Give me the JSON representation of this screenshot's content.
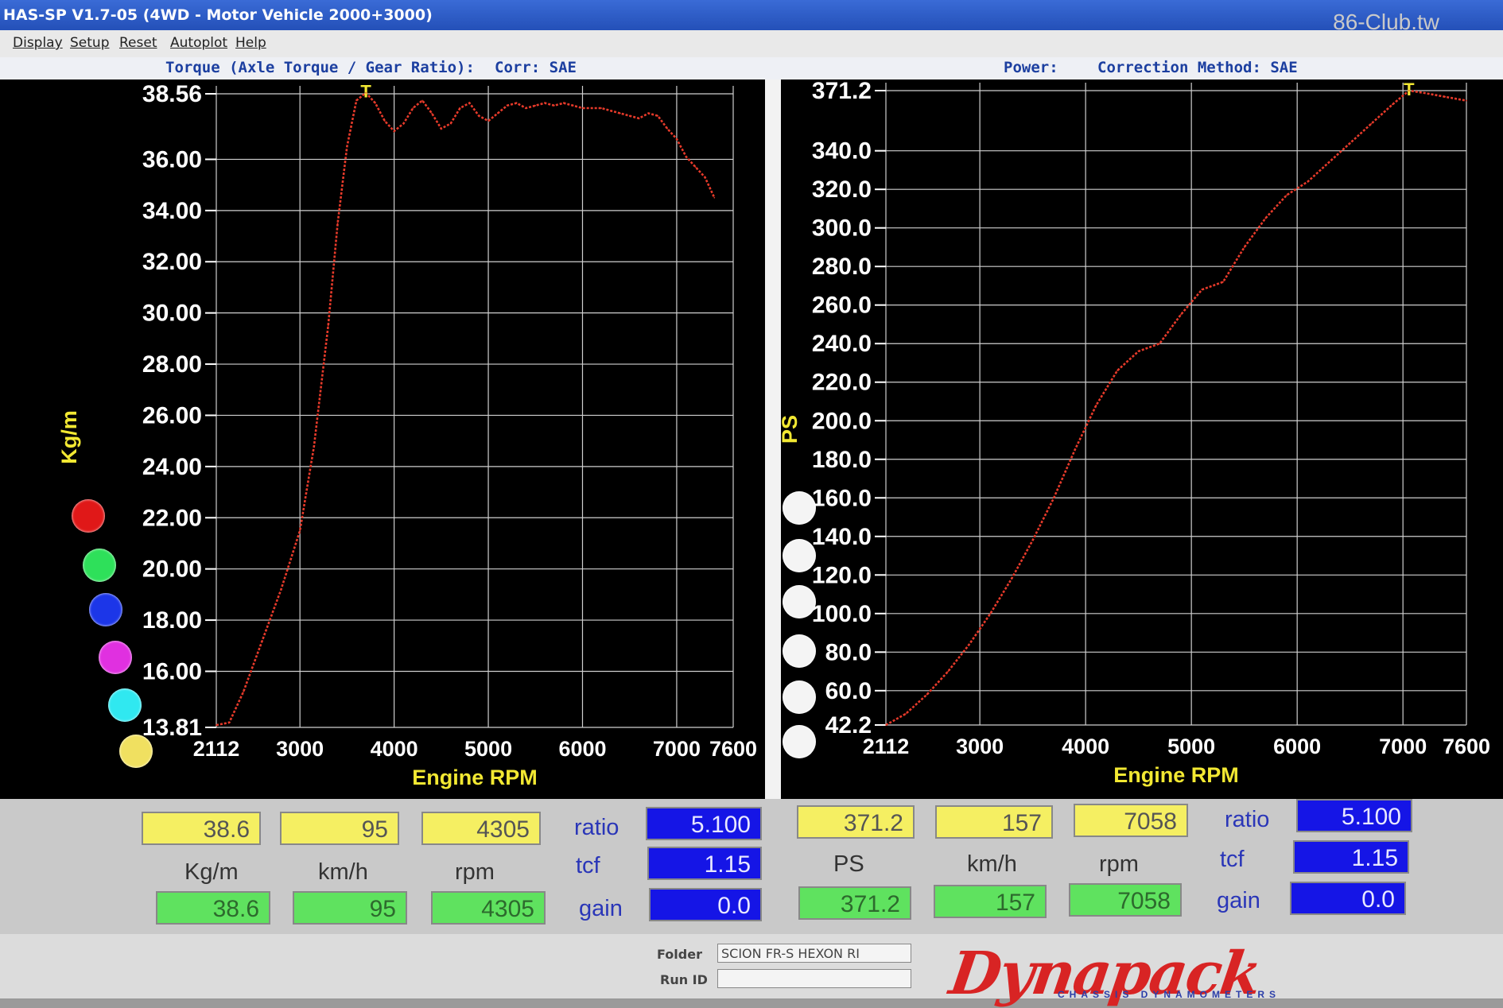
{
  "window": {
    "title": "HAS-SP V1.7-05  (4WD - Motor Vehicle 2000+3000)",
    "watermark": "86-Club.tw"
  },
  "menu": {
    "items": [
      "Display",
      "Setup",
      "Reset",
      "Autoplot",
      "Help"
    ]
  },
  "header": {
    "left_title": "Torque (Axle Torque / Gear Ratio):",
    "left_corr": "Corr: SAE",
    "right_title": "Power:",
    "right_corr": "Correction Method: SAE"
  },
  "colors": {
    "curve": "#e63a2a",
    "grid": "#cfcfcf",
    "axis_title": "#f2e832",
    "swatches": [
      "#e01818",
      "#2ee05a",
      "#1c36e8",
      "#e030e0",
      "#30e8f0",
      "#f0e060"
    ],
    "right_swatches": [
      "#f4f4f4",
      "#f4f4f4",
      "#f4f4f4",
      "#f4f4f4",
      "#f4f4f4",
      "#f4f4f4"
    ]
  },
  "chart_data": [
    {
      "type": "line",
      "ylabel": "Kg/m",
      "xlabel": "Engine RPM",
      "ylim": [
        13.81,
        38.56
      ],
      "xlim": [
        2112,
        7600
      ],
      "yticks": [
        "38.56",
        "36.00",
        "34.00",
        "32.00",
        "30.00",
        "28.00",
        "26.00",
        "24.00",
        "22.00",
        "20.00",
        "18.00",
        "16.00",
        "13.81"
      ],
      "xticks": [
        "2112",
        "3000",
        "4000",
        "5000",
        "6000",
        "7000",
        "7600"
      ],
      "marker_label": "T",
      "series": [
        {
          "x": [
            2112,
            2250,
            2400,
            2600,
            2800,
            3000,
            3150,
            3300,
            3400,
            3500,
            3600,
            3700,
            3800,
            3900,
            4000,
            4100,
            4200,
            4300,
            4400,
            4500,
            4600,
            4700,
            4800,
            4900,
            5000,
            5100,
            5200,
            5300,
            5400,
            5500,
            5600,
            5700,
            5800,
            5900,
            6000,
            6100,
            6200,
            6300,
            6400,
            6500,
            6600,
            6700,
            6800,
            6900,
            7000,
            7100,
            7200,
            7300,
            7400
          ],
          "y": [
            13.9,
            14.0,
            15.2,
            17.2,
            19.2,
            21.5,
            24.8,
            29.5,
            33.5,
            36.5,
            38.3,
            38.6,
            38.2,
            37.5,
            37.1,
            37.4,
            38.0,
            38.3,
            37.8,
            37.2,
            37.4,
            38.0,
            38.2,
            37.7,
            37.5,
            37.8,
            38.1,
            38.2,
            38.0,
            38.1,
            38.2,
            38.1,
            38.2,
            38.1,
            38.0,
            38.0,
            38.0,
            37.9,
            37.8,
            37.7,
            37.6,
            37.8,
            37.7,
            37.2,
            36.8,
            36.1,
            35.7,
            35.3,
            34.5
          ]
        }
      ]
    },
    {
      "type": "line",
      "ylabel": "PS",
      "xlabel": "Engine RPM",
      "ylim": [
        42.2,
        371.2
      ],
      "xlim": [
        2112,
        7600
      ],
      "yticks": [
        "371.2",
        "340.0",
        "320.0",
        "300.0",
        "280.0",
        "260.0",
        "240.0",
        "220.0",
        "200.0",
        "180.0",
        "160.0",
        "140.0",
        "120.0",
        "100.0",
        "80.0",
        "60.0",
        "42.2"
      ],
      "xticks": [
        "2112",
        "3000",
        "4000",
        "5000",
        "6000",
        "7000",
        "7600"
      ],
      "marker_label": "T",
      "series": [
        {
          "x": [
            2112,
            2300,
            2500,
            2700,
            2900,
            3100,
            3300,
            3500,
            3700,
            3900,
            4100,
            4300,
            4500,
            4700,
            4900,
            5100,
            5300,
            5500,
            5700,
            5900,
            6100,
            6300,
            6500,
            6700,
            6900,
            7058,
            7200,
            7400,
            7600
          ],
          "y": [
            42.2,
            48,
            58,
            70,
            84,
            100,
            118,
            138,
            160,
            185,
            208,
            226,
            236,
            240,
            255,
            268,
            272,
            290,
            305,
            317,
            324,
            334,
            344,
            354,
            364,
            371.2,
            370,
            368,
            366
          ]
        }
      ]
    }
  ],
  "left_panel": {
    "box1": "38.6",
    "box2": "95",
    "box3": "4305",
    "label1": "Kg/m",
    "label2": "km/h",
    "label3": "rpm",
    "g1": "38.6",
    "g2": "95",
    "g3": "4305",
    "ratio_label": "ratio",
    "tcf_label": "tcf",
    "gain_label": "gain",
    "ratio": "5.100",
    "tcf": "1.15",
    "gain": "0.0"
  },
  "right_panel": {
    "box1": "371.2",
    "box2": "157",
    "box3": "7058",
    "label1": "PS",
    "label2": "km/h",
    "label3": "rpm",
    "g1": "371.2",
    "g2": "157",
    "g3": "7058",
    "ratio_label": "ratio",
    "tcf_label": "tcf",
    "gain_label": "gain",
    "ratio": "5.100",
    "tcf": "1.15",
    "gain": "0.0"
  },
  "footer": {
    "folder_label": "Folder",
    "folder_value": "SCION FR-S HEXON RI",
    "runid_label": "Run ID",
    "runid_value": "",
    "logo": "Dynapack",
    "logo_sub": "CHASSIS   DYNAMOMETERS"
  }
}
